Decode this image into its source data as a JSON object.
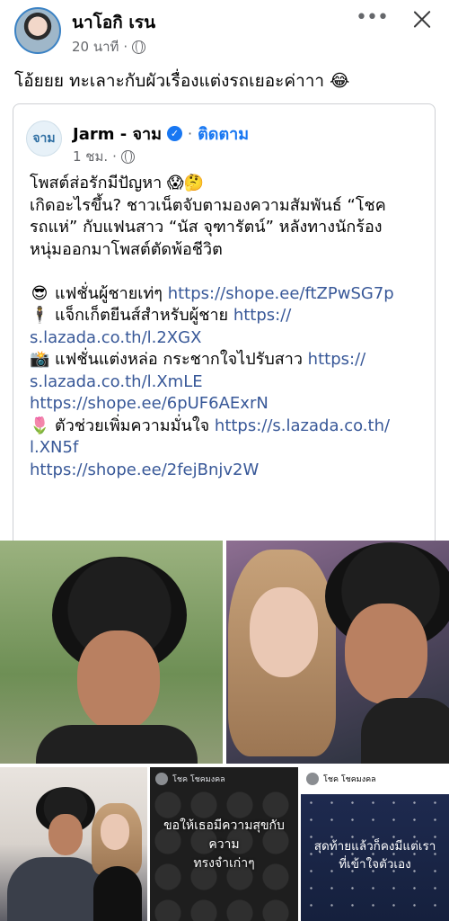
{
  "post": {
    "author": "นาโอกิ เรน",
    "time": "20 นาที",
    "dot": "·",
    "caption": "โอ้ยยย ทะเลาะกับผัวเรื่องแต่งรถเยอะค่าาา 😂",
    "more_icon": "•••"
  },
  "shared": {
    "page_avatar_text": "จาม",
    "page_name": "Jarm - จาม",
    "verified_icon": "✓",
    "dot": "·",
    "follow": "ติดตาม",
    "time": "1 ชม.",
    "lines": {
      "l1": "โพสต์ส่อรักมีปัญหา 😱🤔",
      "l2": "เกิดอะไรขึ้น? ชาวเน็ตจับตามองความสัมพันธ์ “โชค",
      "l3": "รถแห่” กับแฟนสาว “นัส จุฑารัตน์” หลังทางนักร้อง",
      "l4": "หนุ่มออกมาโพสต์ตัดพ้อชีวิต",
      "i1_emoji": "😎",
      "i1_text": "แฟชั่นผู้ชายเท่ๆ ",
      "i1_link": "https://shope.ee/ftZPwSG7p",
      "i2_emoji": "🕴",
      "i2_text": "แจ็กเก็ตยีนส์สำหรับผู้ชาย ",
      "i2_link_a": "https://",
      "i2_link_b": "s.lazada.co.th/l.2XGX",
      "i3_emoji": "📸",
      "i3_text": "แฟชั่นแต่งหล่อ กระชากใจไปรับสาว ",
      "i3_link_a": "https://",
      "i3_link_b": "s.lazada.co.th/l.XmLE",
      "i3_link_c": "https://shope.ee/6pUF6AExrN",
      "i4_emoji": "🌷",
      "i4_text": "ตัวช่วยเพิ่มความมั่นใจ ",
      "i4_link_a": "https://s.lazada.co.th/",
      "i4_link_b": "l.XN5f",
      "i4_link_c": "https://shope.ee/2fejBnjv2W"
    }
  },
  "photos": {
    "p4_header": "โชค โชคมงคล",
    "p4_quote_1": "ขอให้เธอมีความสุขกับความ",
    "p4_quote_2": "ทรงจำเก่าๆ",
    "p5_header": "โชค โชคมงคล",
    "p5_quote_1": "สุดท้ายแล้วก็คงมีแต่เรา",
    "p5_quote_2": "ที่เข้าใจตัวเอง"
  }
}
